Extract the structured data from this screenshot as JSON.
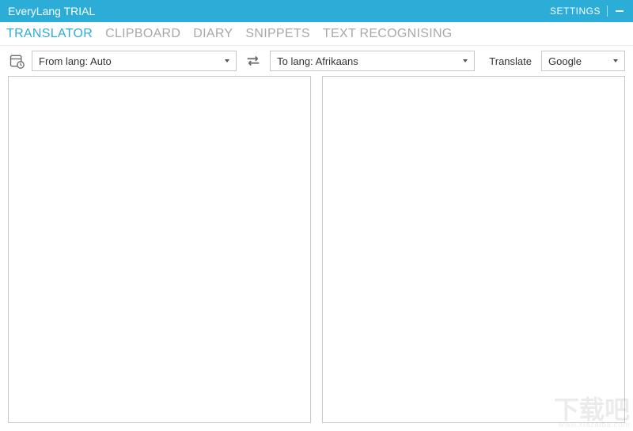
{
  "titlebar": {
    "title": "EveryLang TRIAL",
    "settings": "SETTINGS"
  },
  "tabs": [
    {
      "label": "TRANSLATOR",
      "active": true
    },
    {
      "label": "CLIPBOARD",
      "active": false
    },
    {
      "label": "DIARY",
      "active": false
    },
    {
      "label": "SNIPPETS",
      "active": false
    },
    {
      "label": "TEXT RECOGNISING",
      "active": false
    }
  ],
  "toolbar": {
    "from_lang": "From lang: Auto",
    "to_lang": "To lang: Afrikaans",
    "translate_label": "Translate",
    "provider": "Google"
  },
  "panes": {
    "source_text": "",
    "target_text": ""
  },
  "watermark": {
    "main": "下载吧",
    "sub": "www.xiazaiba.com"
  }
}
